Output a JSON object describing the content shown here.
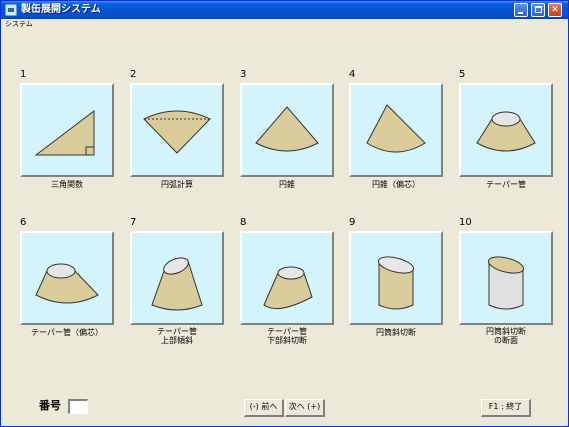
{
  "window": {
    "title": "製缶展開システム"
  },
  "menu": {
    "items": [
      {
        "label": "システム"
      }
    ]
  },
  "items": [
    {
      "number": "1",
      "label": "三角関数",
      "shape": "right-triangle"
    },
    {
      "number": "2",
      "label": "円弧計算",
      "shape": "circular-sector"
    },
    {
      "number": "3",
      "label": "円錐",
      "shape": "cone"
    },
    {
      "number": "4",
      "label": "円錐（偏芯）",
      "shape": "oblique-cone"
    },
    {
      "number": "5",
      "label": "テーパー管",
      "shape": "tapered-pipe"
    },
    {
      "number": "6",
      "label": "テーパー管（偏芯）",
      "shape": "eccentric-tapered-pipe"
    },
    {
      "number": "7",
      "label": "テーパー管",
      "label2": "上部傾斜",
      "shape": "tapered-pipe-top-slant"
    },
    {
      "number": "8",
      "label": "テーパー管",
      "label2": "下部斜切断",
      "shape": "tapered-pipe-bottom-cut"
    },
    {
      "number": "9",
      "label": "円筒斜切断",
      "shape": "cylinder-oblique-cut"
    },
    {
      "number": "10",
      "label": "円筒斜切断",
      "label2": "の断面",
      "shape": "cylinder-cut-section"
    }
  ],
  "footer": {
    "number_label": "番号",
    "number_value": "",
    "prev_button": "(-) 前へ",
    "next_button": "次へ (+)",
    "exit_button": "F1 : 終了"
  },
  "colors": {
    "panel_bg": "#d4f4fc",
    "shape_fill": "#d9cc9a",
    "ellipse_fill": "#e6e6e6",
    "titlebar": "#0453d6"
  }
}
